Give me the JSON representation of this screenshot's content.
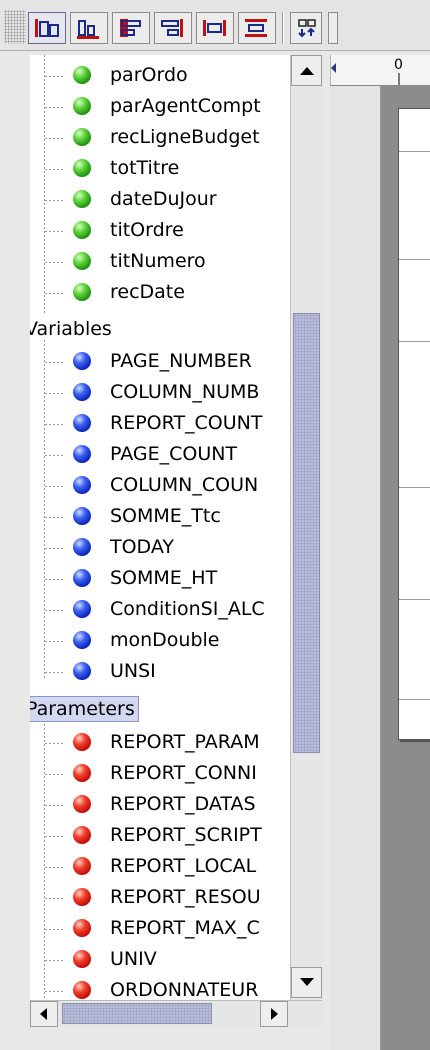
{
  "toolbar": {
    "buttons": [
      {
        "icon": "align-left-icon",
        "selected": true
      },
      {
        "icon": "align-bottom-icon",
        "selected": false
      },
      {
        "icon": "align-center-horizontal-icon",
        "selected": false
      },
      {
        "icon": "align-right-icon",
        "selected": false
      },
      {
        "icon": "same-width-icon",
        "selected": false
      },
      {
        "icon": "center-vertical-icon",
        "selected": false
      },
      {
        "icon": "bring-forward-icon",
        "selected": false
      }
    ]
  },
  "tree": {
    "fields": [
      "parOrdo",
      "parAgentCompt",
      "recLigneBudget",
      "totTitre",
      "dateDuJour",
      "titOrdre",
      "titNumero",
      "recDate"
    ],
    "variables_label": "Variables",
    "variables": [
      "PAGE_NUMBER",
      "COLUMN_NUMB",
      "REPORT_COUNT",
      "PAGE_COUNT",
      "COLUMN_COUN",
      "SOMME_Ttc",
      "TODAY",
      "SOMME_HT",
      "ConditionSI_ALC",
      "monDouble",
      "UNSI"
    ],
    "parameters_label": "Parameters",
    "parameters": [
      "REPORT_PARAM",
      "REPORT_CONNI",
      "REPORT_DATAS",
      "REPORT_SCRIPT",
      "REPORT_LOCAL",
      "REPORT_RESOU",
      "REPORT_MAX_C",
      "UNIV",
      "ORDONNATEUR"
    ]
  },
  "ruler": {
    "origin_label": "0"
  },
  "colors": {
    "field_ball": "#1b8c0f",
    "variable_ball": "#0a22b8",
    "parameter_ball": "#c00a0a",
    "selection": "#d2d8f0"
  }
}
